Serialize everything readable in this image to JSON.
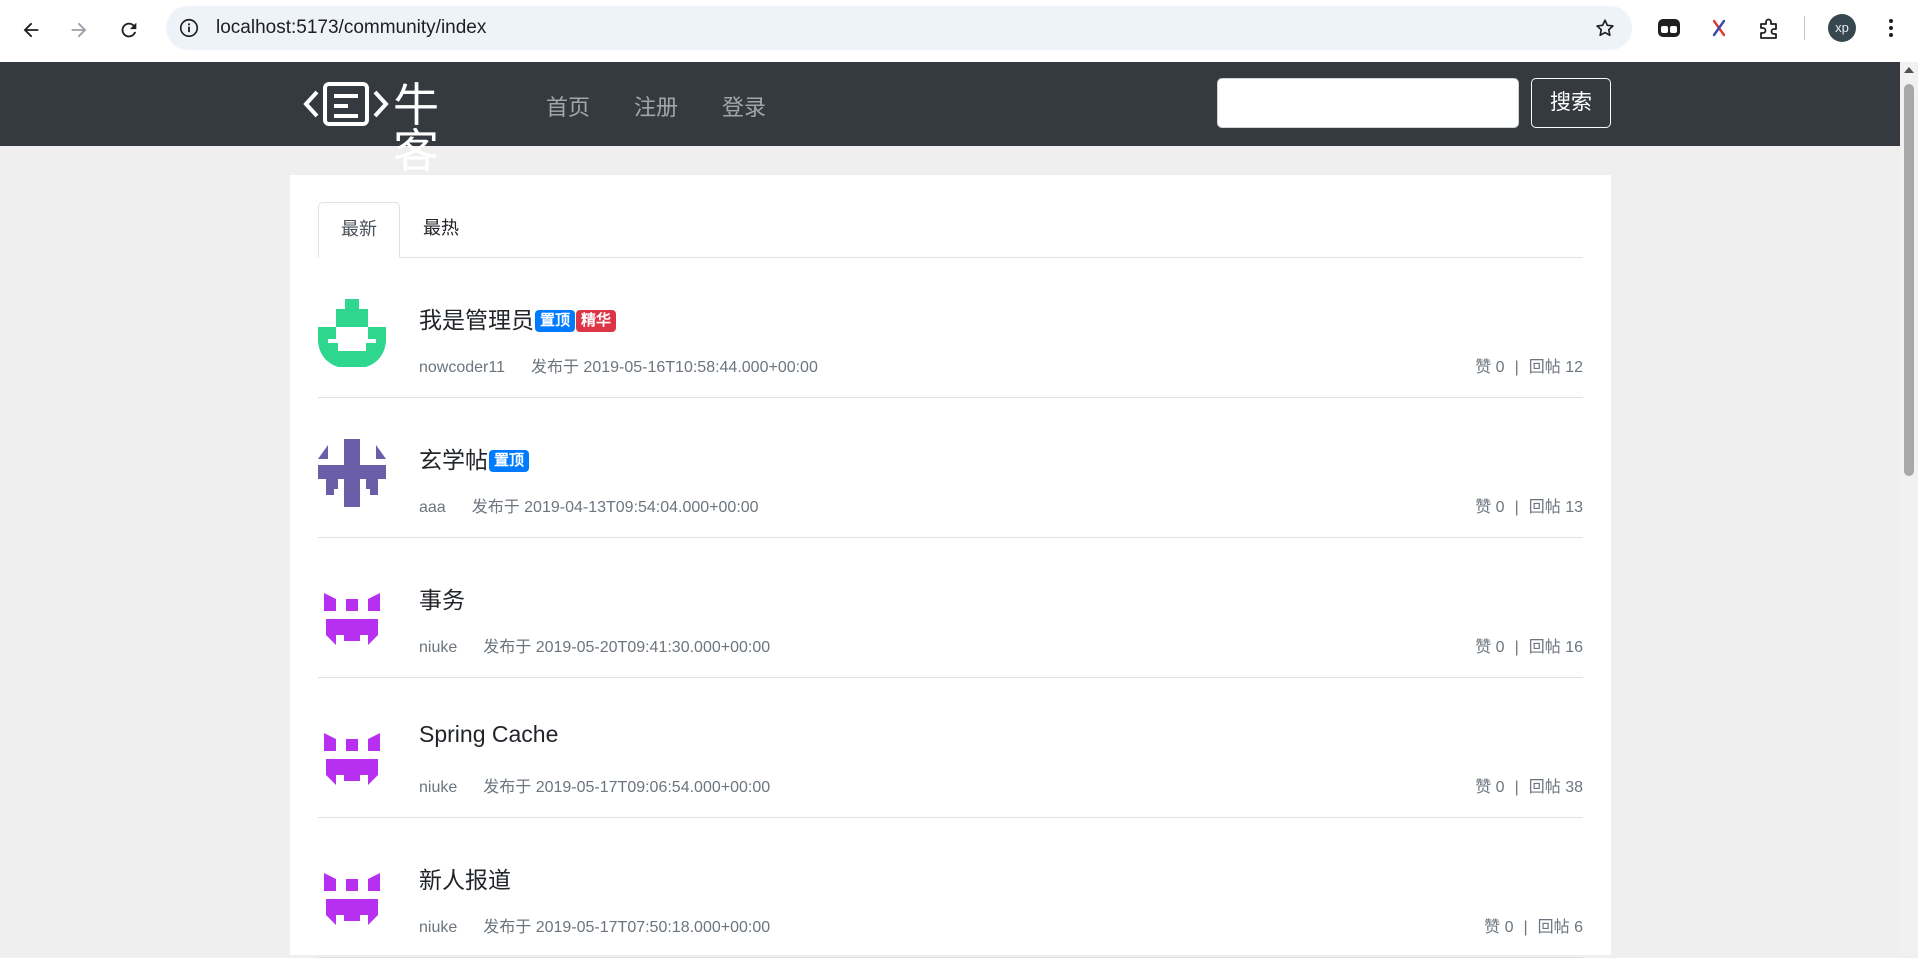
{
  "browser": {
    "url": "localhost:5173/community/index",
    "profile_initials": "xp"
  },
  "site": {
    "brand": "牛客",
    "nav": [
      "首页",
      "注册",
      "登录"
    ],
    "search_button": "搜索"
  },
  "tabs": [
    {
      "label": "最新",
      "active": true
    },
    {
      "label": "最热",
      "active": false
    }
  ],
  "posts": [
    {
      "title": "我是管理员",
      "badges": [
        "置顶",
        "精华"
      ],
      "author": "nowcoder11",
      "published": "发布于 2019-05-16T10:58:44.000+00:00",
      "likes": "赞 0",
      "replies": "回帖 12",
      "avatar_color": "#2ed68e",
      "avatar_icon": "avatar-green-icon"
    },
    {
      "title": "玄学帖",
      "badges": [
        "置顶"
      ],
      "author": "aaa",
      "published": "发布于 2019-04-13T09:54:04.000+00:00",
      "likes": "赞 0",
      "replies": "回帖 13",
      "avatar_color": "#6a5ea8",
      "avatar_icon": "avatar-purple-icon"
    },
    {
      "title": "事务",
      "badges": [],
      "author": "niuke",
      "published": "发布于 2019-05-20T09:41:30.000+00:00",
      "likes": "赞 0",
      "replies": "回帖 16",
      "avatar_color": "#b730f0",
      "avatar_icon": "avatar-violet-icon"
    },
    {
      "title": "Spring Cache",
      "badges": [],
      "author": "niuke",
      "published": "发布于 2019-05-17T09:06:54.000+00:00",
      "likes": "赞 0",
      "replies": "回帖 38",
      "avatar_color": "#b730f0",
      "avatar_icon": "avatar-violet-icon"
    },
    {
      "title": "新人报道",
      "badges": [],
      "author": "niuke",
      "published": "发布于 2019-05-17T07:50:18.000+00:00",
      "likes": "赞 0",
      "replies": "回帖 6",
      "avatar_color": "#b730f0",
      "avatar_icon": "avatar-violet-icon"
    }
  ],
  "colors": {
    "header_bg": "#343a40",
    "badge_top": "#007bff",
    "badge_wonderful": "#dc3545"
  }
}
